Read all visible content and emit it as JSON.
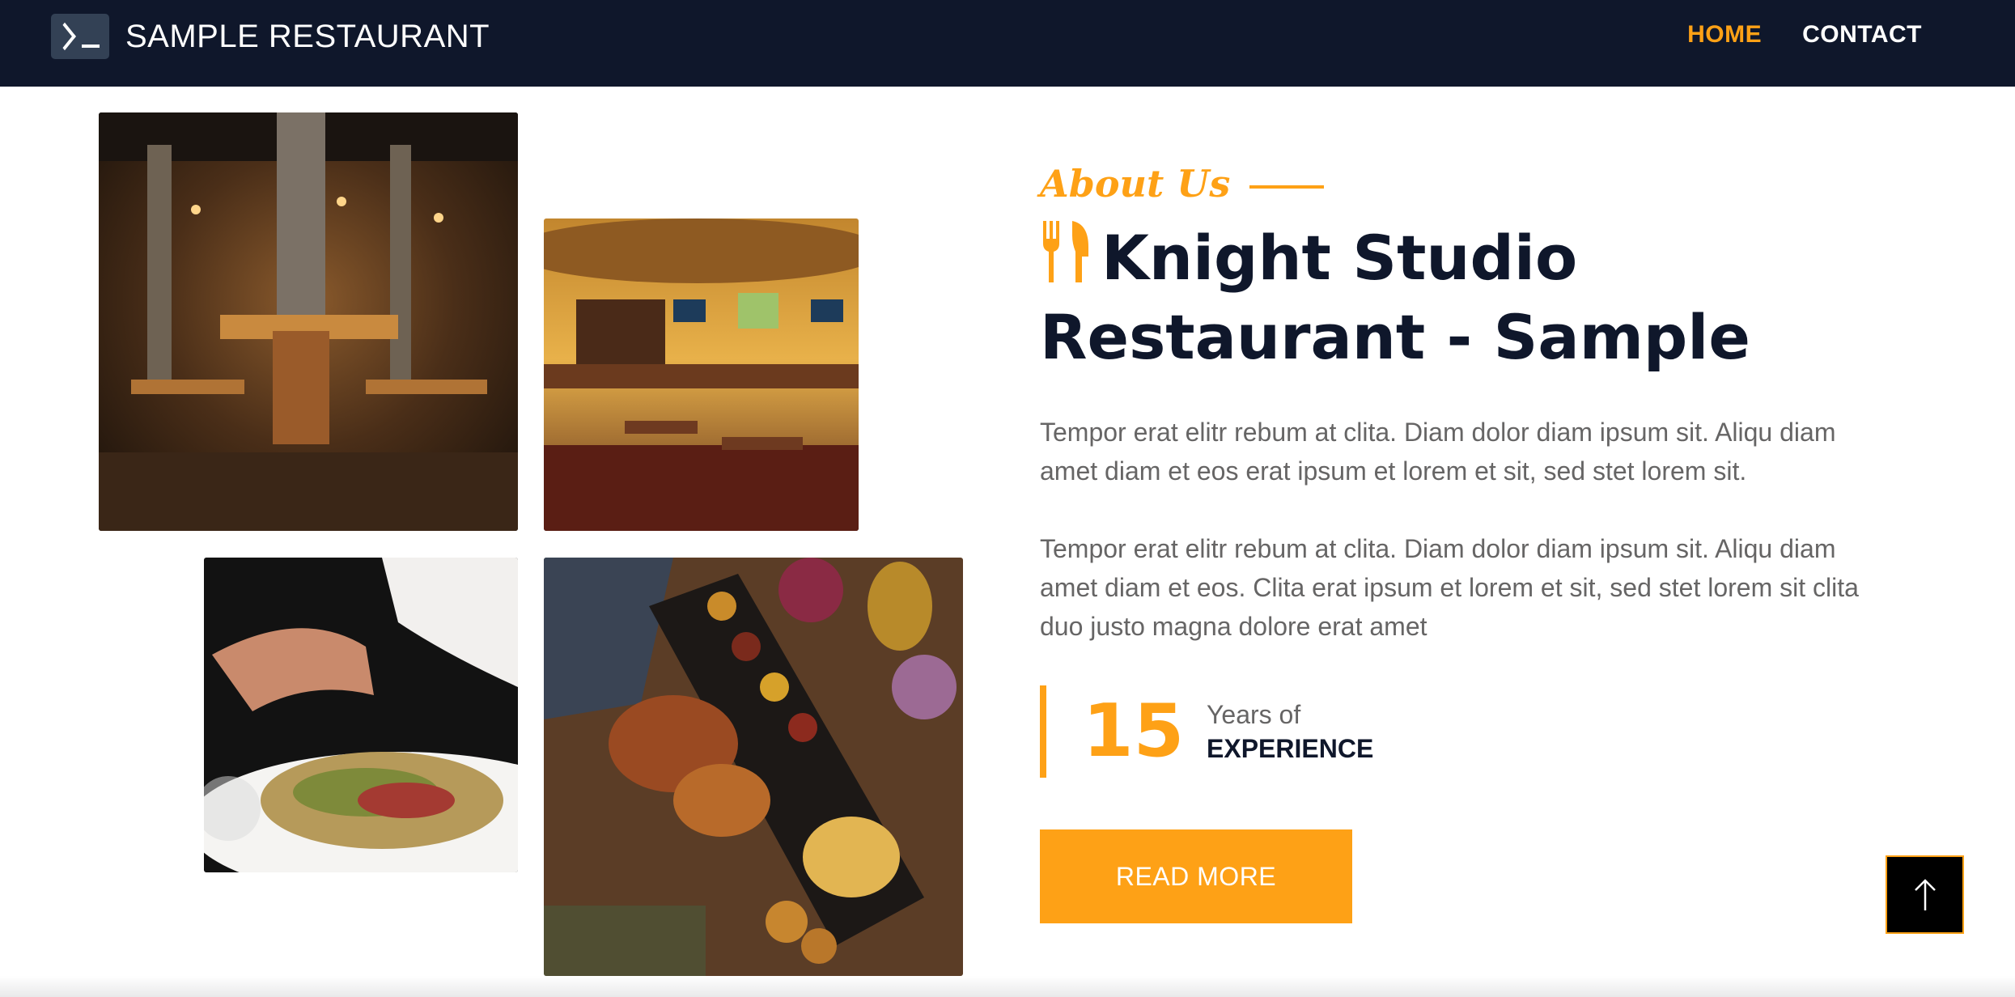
{
  "navbar": {
    "brand_icon": "terminal-icon",
    "brand_name": "SAMPLE RESTAURANT",
    "links": [
      {
        "label": "HOME",
        "active": true
      },
      {
        "label": "CONTACT",
        "active": false
      }
    ]
  },
  "about": {
    "tagline": "About Us",
    "title_icon": "utensils-icon",
    "title": "Knight Studio Restaurant - Sample",
    "paragraphs": [
      "Tempor erat elitr rebum at clita. Diam dolor diam ipsum sit. Aliqu diam amet diam et eos erat ipsum et lorem et sit, sed stet lorem sit.",
      "Tempor erat elitr rebum at clita. Diam dolor diam ipsum sit. Aliqu diam amet diam et eos. Clita erat ipsum et lorem et sit, sed stet lorem sit clita duo justo magna dolore erat amet"
    ],
    "experience": {
      "number": "15",
      "label_small": "Years of",
      "label_big": "EXPERIENCE"
    },
    "button_label": "READ MORE"
  },
  "back_to_top_icon": "arrow-up-icon",
  "colors": {
    "primary": "#fea116",
    "dark": "#0f172b",
    "text": "#666565"
  }
}
